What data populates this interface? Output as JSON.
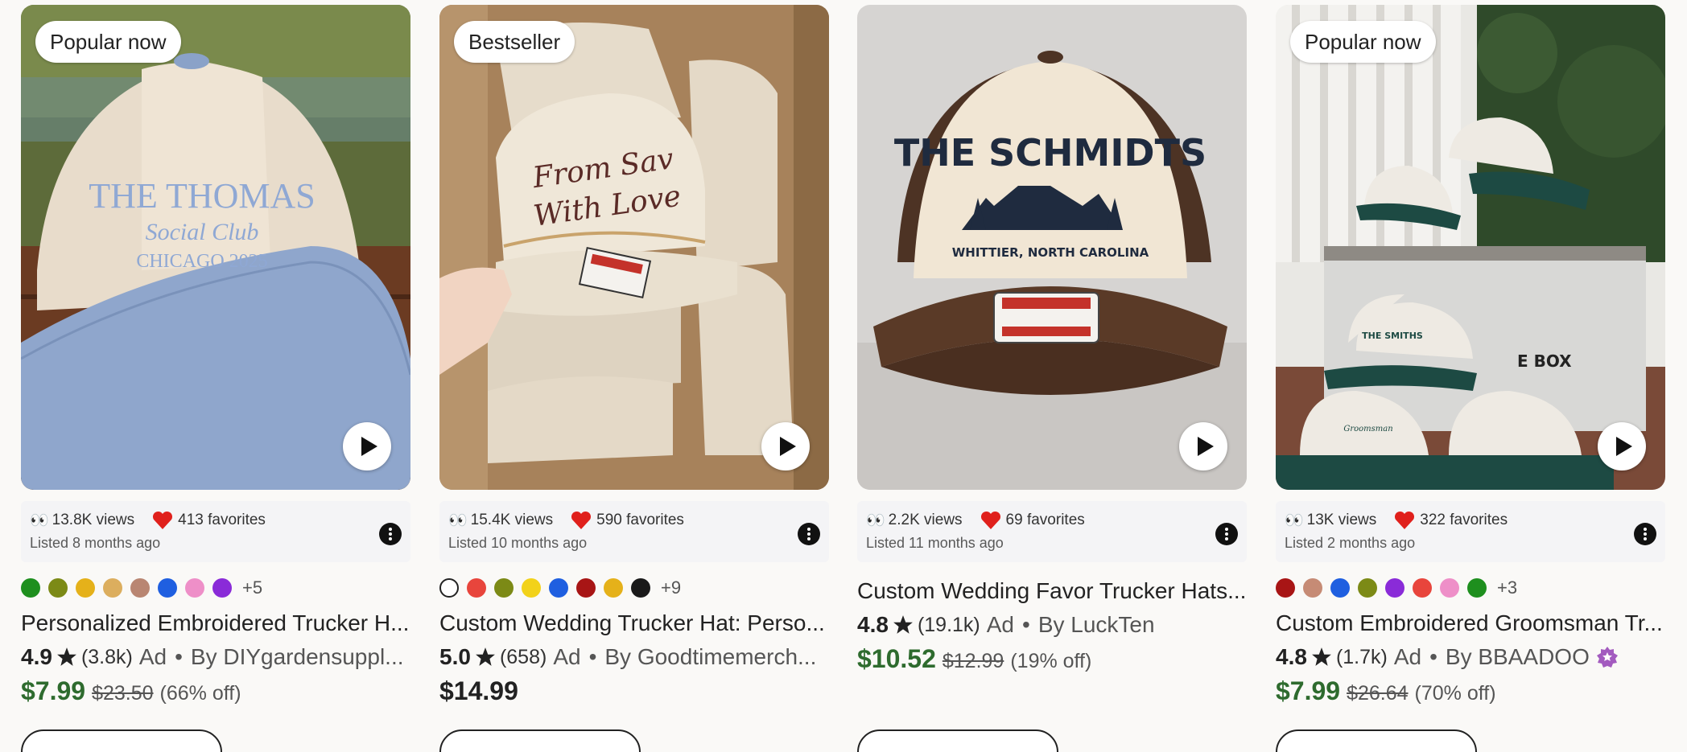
{
  "products": [
    {
      "badge": "Popular now",
      "views": "13.8K views",
      "favorites": "413 favorites",
      "listed": "Listed 8 months ago",
      "swatch_more": "+5",
      "title": "Personalized Embroidered Trucker H...",
      "rating": "4.9",
      "reviews": "(3.8k)",
      "ad": "Ad",
      "shop": "By DIYgardensuppl...",
      "price": "$7.99",
      "original_price": "$23.50",
      "discount": "(66% off)",
      "hat_text_1": "THE THOMAS",
      "hat_text_2": "Social Club",
      "hat_text_3": "CHICAGO 2025"
    },
    {
      "badge": "Bestseller",
      "views": "15.4K views",
      "favorites": "590 favorites",
      "listed": "Listed 10 months ago",
      "swatch_more": "+9",
      "title": "Custom Wedding Trucker Hat: Perso...",
      "rating": "5.0",
      "reviews": "(658)",
      "ad": "Ad",
      "shop": "By Goodtimemerch...",
      "price": "$14.99",
      "hat_text_1": "From Sav",
      "hat_text_2": "With Love"
    },
    {
      "views": "2.2K views",
      "favorites": "69 favorites",
      "listed": "Listed 11 months ago",
      "title": "Custom Wedding Favor Trucker Hats...",
      "rating": "4.8",
      "reviews": "(19.1k)",
      "ad": "Ad",
      "shop": "By LuckTen",
      "price": "$10.52",
      "original_price": "$12.99",
      "discount": "(19% off)",
      "hat_text_1": "THE SCHMIDTS",
      "hat_text_2": "WHITTIER, NORTH CAROLINA"
    },
    {
      "badge": "Popular now",
      "views": "13K views",
      "favorites": "322 favorites",
      "listed": "Listed 2 months ago",
      "swatch_more": "+3",
      "title": "Custom Embroidered Groomsman Tr...",
      "rating": "4.8",
      "reviews": "(1.7k)",
      "ad": "Ad",
      "shop": "By BBAADOO",
      "price": "$7.99",
      "original_price": "$26.64",
      "discount": "(70% off)",
      "hat_text_1": "THE SMITHS",
      "hat_text_2": "Groomsman",
      "box_text": "E BOX"
    }
  ],
  "swatch_colors": {
    "p1": [
      "#1e8f1e",
      "#7c8a16",
      "#e5b11a",
      "#dcae5e",
      "#b98672",
      "#1f5fe0",
      "#ee8fc8",
      "#8a2bd8"
    ],
    "p2": [
      "#ffffff",
      "#e8453c",
      "#7c8a16",
      "#f2d21a",
      "#1f5fe0",
      "#a81515",
      "#e5b11a",
      "#1a1a1a"
    ],
    "p4": [
      "#a81515",
      "#c68b75",
      "#1f5fe0",
      "#7c8a16",
      "#8a2bd8",
      "#e8453c",
      "#ee8fc8",
      "#1e8f1e"
    ]
  },
  "colors": {
    "sale_price": "#2e6b2e",
    "heart": "#e0201c",
    "star_seller": "#a35bbf"
  },
  "icons": [
    "eyes-icon",
    "heart-icon",
    "more-icon",
    "play-icon",
    "star-icon",
    "star-seller-icon"
  ]
}
